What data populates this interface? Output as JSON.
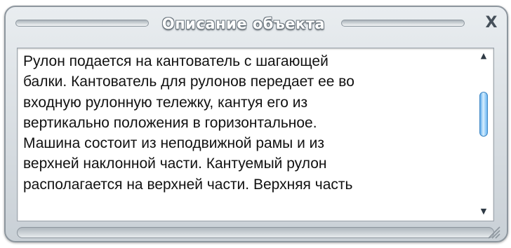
{
  "window": {
    "title": "Описание объекта",
    "close_label": "X"
  },
  "content": {
    "lines": [
      "Рулон подается на кантователь с шагающей",
      "балки. Кантователь для рулонов передает ее во",
      "входную рулонную тележку, кантуя его из",
      "вертикально положения в горизонтальное.",
      "Машина состоит из неподвижной рамы и из",
      "верхней наклонной части. Кантуемый рулон",
      "располагается на верхней части. Верхняя часть"
    ]
  },
  "scrollbar": {
    "up_icon": "triangle-up-icon",
    "down_icon": "triangle-down-icon",
    "up_glyph": "▲",
    "down_glyph": "▼"
  },
  "colors": {
    "frame": "#c9d0d6",
    "thumb": "#5aa8ea",
    "title_text": "#ffffff"
  }
}
